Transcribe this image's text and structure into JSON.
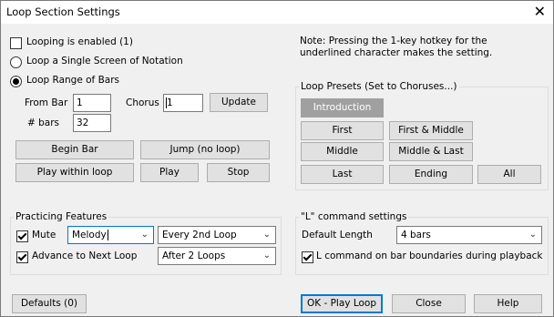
{
  "window": {
    "title": "Loop Section Settings",
    "close_glyph": "✕"
  },
  "left": {
    "looping_enabled": {
      "label": "Looping is enabled (1)",
      "checked": false
    },
    "loop_single_screen": {
      "label": "Loop a Single Screen of Notation",
      "selected": false
    },
    "loop_range": {
      "label": "Loop Range of Bars",
      "selected": true
    },
    "from_bar": {
      "label": "From Bar",
      "value": "1"
    },
    "chorus": {
      "label": "Chorus #",
      "value": "1"
    },
    "bars": {
      "label": "# bars",
      "value": "32"
    },
    "update_button": "Update",
    "begin_bar_button": "Begin Bar",
    "jump_button": "Jump (no loop)",
    "play_within_button": "Play within loop",
    "play_button": "Play",
    "stop_button": "Stop"
  },
  "note": "Note: Pressing the 1-key hotkey for the underlined character makes the setting.",
  "presets": {
    "label": "Loop Presets (Set to Choruses...)",
    "introduction": "Introduction",
    "first": "First",
    "first_middle": "First & Middle",
    "middle": "Middle",
    "middle_last": "Middle & Last",
    "last": "Last",
    "ending": "Ending",
    "all": "All"
  },
  "practicing": {
    "label": "Practicing Features",
    "mute": {
      "label": "Mute",
      "checked": true,
      "part": "Melody",
      "frequency": "Every 2nd Loop"
    },
    "advance": {
      "label": "Advance to Next Loop",
      "checked": true,
      "after": "After 2 Loops"
    }
  },
  "lcommand": {
    "label": "\"L\" command settings",
    "default_length_label": "Default Length",
    "default_length_value": "4 bars",
    "boundaries": {
      "label": "L command on bar boundaries during playback",
      "checked": true
    }
  },
  "footer": {
    "defaults_button": "Defaults (0)",
    "ok_button": "OK - Play Loop",
    "close_button": "Close",
    "help_button": "Help"
  }
}
